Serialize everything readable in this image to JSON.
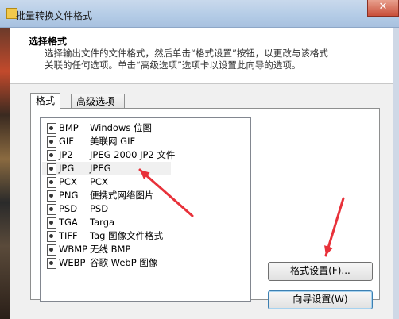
{
  "window": {
    "title": "批量转换文件格式",
    "close_glyph": "✕"
  },
  "header": {
    "title": "选择格式",
    "description_line1": "选择输出文件的文件格式，然后单击“格式设置”按钮，以更改与该格式",
    "description_line2": "关联的任何选项。单击“高级选项”选项卡以设置此向导的选项。"
  },
  "tabs": [
    {
      "label": "格式",
      "active": true
    },
    {
      "label": "高级选项",
      "active": false
    }
  ],
  "formats": [
    {
      "code": "BMP",
      "desc": "Windows 位图"
    },
    {
      "code": "GIF",
      "desc": "美联网 GIF"
    },
    {
      "code": "JP2",
      "desc": "JPEG 2000 JP2 文件"
    },
    {
      "code": "JPG",
      "desc": "JPEG",
      "selected": true
    },
    {
      "code": "PCX",
      "desc": "PCX"
    },
    {
      "code": "PNG",
      "desc": "便携式网络图片"
    },
    {
      "code": "PSD",
      "desc": "PSD"
    },
    {
      "code": "TGA",
      "desc": "Targa"
    },
    {
      "code": "TIFF",
      "desc": "Tag 图像文件格式"
    },
    {
      "code": "WBMP",
      "desc": "无线 BMP"
    },
    {
      "code": "WEBP",
      "desc": "谷歌 WebP 图像"
    }
  ],
  "buttons": {
    "format_settings": "格式设置(F)...",
    "wizard_settings": "向导设置(W)"
  },
  "annotations": {
    "arrow_color": "#e8313a"
  },
  "icons": {
    "file": "image-file-icon"
  }
}
